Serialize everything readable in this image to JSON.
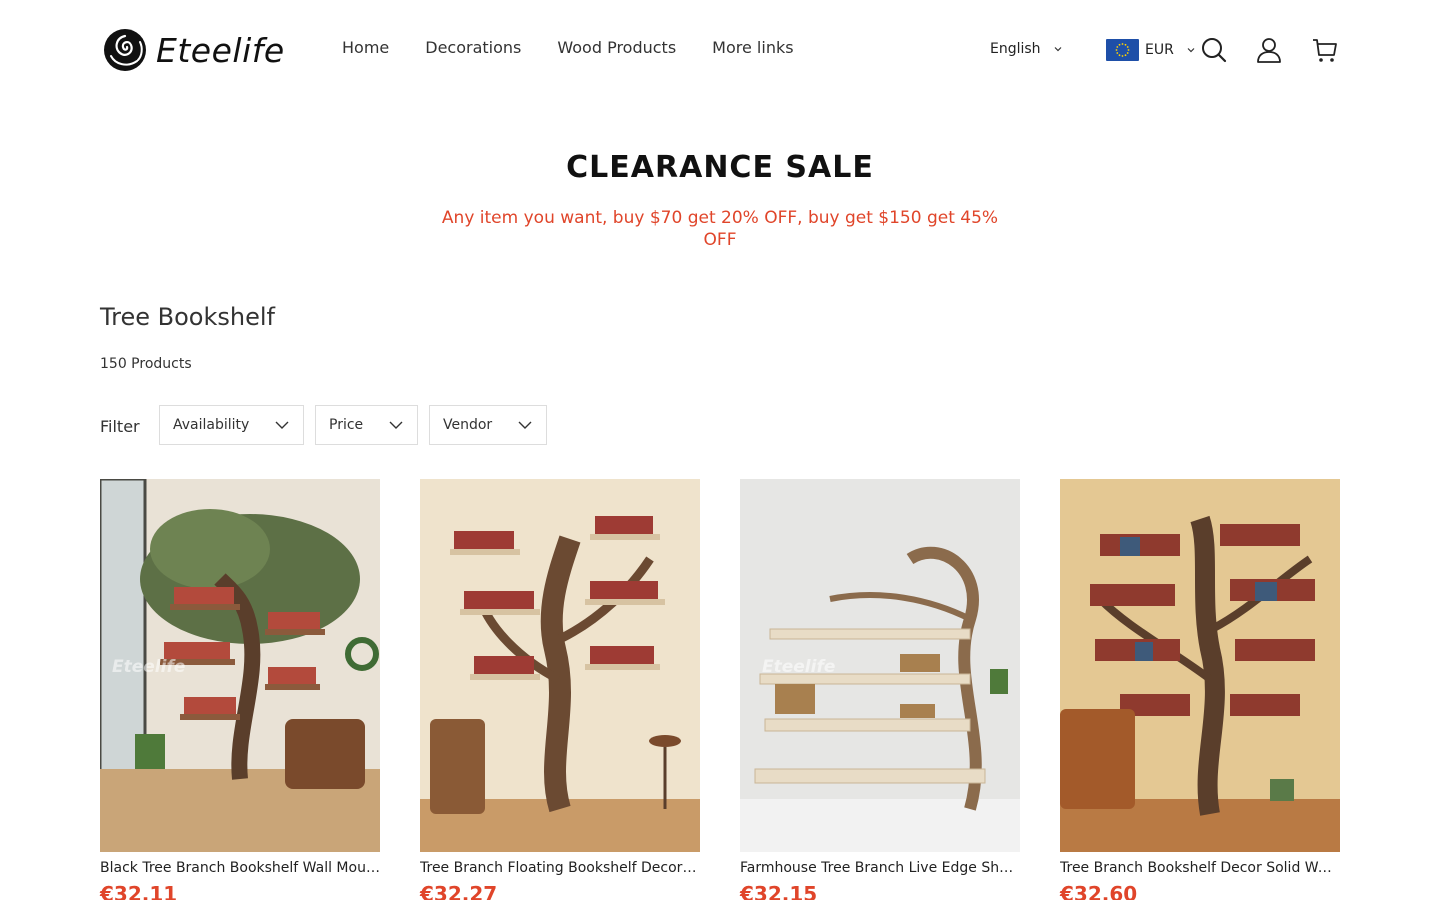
{
  "brand": {
    "name": "Eteelife"
  },
  "nav": {
    "items": [
      {
        "label": "Home"
      },
      {
        "label": "Decorations"
      },
      {
        "label": "Wood Products"
      },
      {
        "label": "More links"
      }
    ]
  },
  "header": {
    "language": "English",
    "currency": "EUR",
    "icons": [
      "search-icon",
      "account-icon",
      "cart-icon"
    ]
  },
  "promo": {
    "title": "CLEARANCE SALE",
    "subtitle": "Any item you want, buy $70 get 20% OFF, buy get $150 get 45% OFF"
  },
  "collection": {
    "title": "Tree Bookshelf",
    "count": "150 Products",
    "filter_label": "Filter",
    "filters": [
      {
        "label": "Availability"
      },
      {
        "label": "Price"
      },
      {
        "label": "Vendor"
      }
    ]
  },
  "products": [
    {
      "name": "Black Tree Branch Bookshelf Wall Mounted Floating Shelves",
      "price": "€32,11",
      "watermark": "Eteelife"
    },
    {
      "name": "Tree Branch Floating Bookshelf Decorative Wall Shelf",
      "price": "€32,27",
      "watermark": ""
    },
    {
      "name": "Farmhouse Tree Branch Live Edge Shelf Bookshelf",
      "price": "€32,15",
      "watermark": "Eteelife"
    },
    {
      "name": "Tree Branch Bookshelf Decor Solid Wood Wall Shelf",
      "price": "€32,60",
      "watermark": ""
    }
  ],
  "colors": {
    "accent": "#e0452a",
    "text": "#222222",
    "border": "#dddddd"
  }
}
